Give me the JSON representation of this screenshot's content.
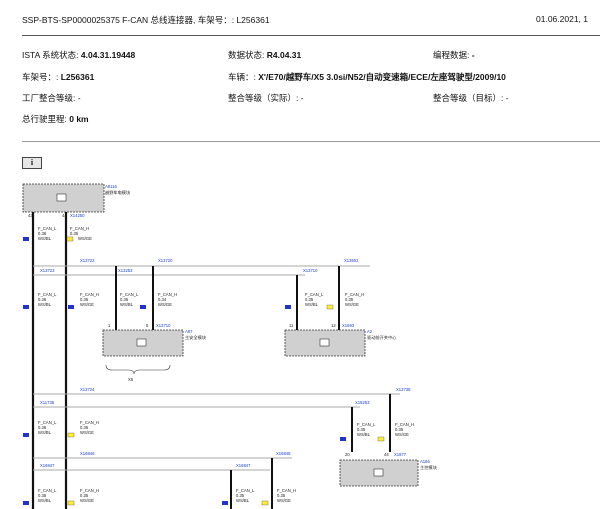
{
  "header": {
    "title": "SSP-BTS-SP0000025375 F-CAN 总线连接器, 车架号：: L256361",
    "date": "01.06.2021, 1"
  },
  "meta": {
    "ista_label": "ISTA 系统状态: ",
    "ista_value": "4.04.31.19448",
    "data_label": "数据状态: ",
    "data_value": "R4.04.31",
    "prog_label": "编程数据: ",
    "prog_value": "-",
    "vin_label": "车架号：: ",
    "vin_value": "L256361",
    "vehicle_label": "车辆：: ",
    "vehicle_value": "X'/E70/越野车/X5 3.0si/N52/自动变速箱/ECE/左座驾驶型/2009/10",
    "factory_label": "工厂整合等级: ",
    "factory_value": "-",
    "actual_label": "整合等级（实际）: ",
    "actual_value": "-",
    "target_label": "整合等级（目标）: ",
    "target_value": "-",
    "mileage_label": "总行驶里程: ",
    "mileage_value": "0 km"
  },
  "info_icon": "i",
  "diagram": {
    "module_top_id": "A8116",
    "module_top_name": "越野车电模块",
    "pin_43": "43",
    "pin_44": "44",
    "conn_x14250": "X14250",
    "wire_can_l": "F_CAN_L",
    "wire_can_h": "F_CAN_H",
    "gauge_035": "0.35",
    "gauge_036": "0.36",
    "color_wsbl": "WS/BL",
    "color_wsge": "WS/GE",
    "x13722": "X13722",
    "x13723": "X13723",
    "x13253": "X13253",
    "x13720": "X13720",
    "x13502": "X13502",
    "x13710": "X13710",
    "x11702": "X11702",
    "x13710_b": "X13710",
    "x1693": "X1693",
    "pin_1": "1",
    "pin_5": "5",
    "pin_11": "11",
    "pin_12": "12",
    "a87_id": "A87",
    "a87_name": "主安全模块",
    "a2_id": "A2",
    "a2_name": "驱动前开关中心",
    "x6_label": "X6",
    "x13724": "X13724",
    "x11735": "X11735",
    "x13738": "X13738",
    "x18253": "X18253",
    "x1877": "X1877",
    "x16846": "X16846",
    "x16848": "X16848",
    "pin_20": "20",
    "pin_44b": "44",
    "a166_id": "A166",
    "a166_name": "主控模块",
    "x16847": "X16847",
    "x16847_b": "X16847",
    "gauge_034": "0.34",
    "color_wsbl_c": "WS/BL",
    "color_wsge_c": "WS/GE"
  },
  "colors": {
    "blue_marker": "#2233cc",
    "yellow_marker": "#ffee33",
    "module_fill": "#d0d0d0",
    "wire_black": "#111111"
  }
}
